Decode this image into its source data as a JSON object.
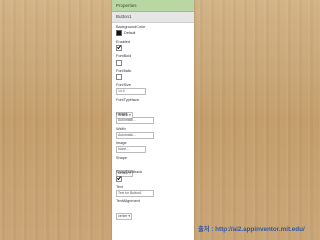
{
  "panel": {
    "title": "Properties",
    "component": "Button1"
  },
  "properties": {
    "background_color": {
      "label": "BackgroundColor",
      "value": "Default",
      "swatch_color": "#111111"
    },
    "enabled": {
      "label": "Enabled",
      "checked": true
    },
    "font_bold": {
      "label": "FontBold",
      "checked": false
    },
    "font_italic": {
      "label": "FontItalic",
      "checked": false
    },
    "font_size": {
      "label": "FontSize",
      "value": "14.0"
    },
    "font_typeface": {
      "label": "FontTypeface",
      "value": "default ▾"
    },
    "height": {
      "label": "Height",
      "value": "Automatic..."
    },
    "width": {
      "label": "Width",
      "value": "Automatic..."
    },
    "image": {
      "label": "Image",
      "value": "None..."
    },
    "shape": {
      "label": "Shape",
      "value": "default ▾"
    },
    "show_feedback": {
      "label": "ShowFeedback",
      "checked": true
    },
    "text": {
      "label": "Text",
      "value": "Text for Button1"
    },
    "text_alignment": {
      "label": "TextAlignment",
      "value": "center ▾"
    }
  },
  "caption": "출처 : http://ai2.appinventor.mit.edu/",
  "colors": {
    "header_green": "#b9d7a3",
    "caption_blue": "#2e57a8",
    "background_wood": "#c9a878"
  }
}
